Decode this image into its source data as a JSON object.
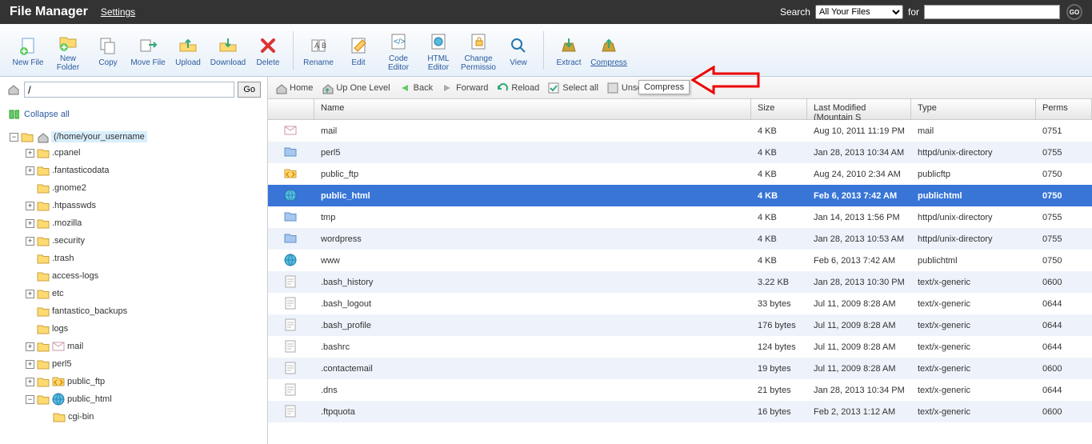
{
  "header": {
    "title": "File Manager",
    "settings": "Settings",
    "search_label": "Search",
    "search_scope": "All Your Files",
    "for_label": "for",
    "search_value": "",
    "go_label": "GO"
  },
  "toolbar": {
    "new_file": "New File",
    "new_folder": "New\nFolder",
    "copy": "Copy",
    "move_file": "Move File",
    "upload": "Upload",
    "download": "Download",
    "delete": "Delete",
    "rename": "Rename",
    "edit": "Edit",
    "code_editor": "Code\nEditor",
    "html_editor": "HTML\nEditor",
    "change_perm": "Change\nPermissio",
    "view": "View",
    "extract": "Extract",
    "compress": "Compress"
  },
  "tooltip": "Compress",
  "pathbar": {
    "path": "/",
    "go": "Go"
  },
  "tree": {
    "collapse": "Collapse all",
    "root": "(/home/your_username",
    "items": [
      {
        "name": ".cpanel",
        "expandable": true,
        "indent": 1
      },
      {
        "name": ".fantasticodata",
        "expandable": true,
        "indent": 1
      },
      {
        "name": ".gnome2",
        "expandable": false,
        "indent": 1
      },
      {
        "name": ".htpasswds",
        "expandable": true,
        "indent": 1
      },
      {
        "name": ".mozilla",
        "expandable": true,
        "indent": 1
      },
      {
        "name": ".security",
        "expandable": true,
        "indent": 1
      },
      {
        "name": ".trash",
        "expandable": false,
        "indent": 1
      },
      {
        "name": "access-logs",
        "expandable": false,
        "indent": 1
      },
      {
        "name": "etc",
        "expandable": true,
        "indent": 1
      },
      {
        "name": "fantastico_backups",
        "expandable": false,
        "indent": 1
      },
      {
        "name": "logs",
        "expandable": false,
        "indent": 1
      },
      {
        "name": "mail",
        "expandable": true,
        "indent": 1,
        "icon": "mail"
      },
      {
        "name": "perl5",
        "expandable": true,
        "indent": 1
      },
      {
        "name": "public_ftp",
        "expandable": true,
        "indent": 1,
        "icon": "ftp"
      },
      {
        "name": "public_html",
        "expandable": true,
        "expanded": true,
        "indent": 1,
        "icon": "globe"
      },
      {
        "name": "cgi-bin",
        "expandable": false,
        "indent": 2
      }
    ]
  },
  "navbar": {
    "home": "Home",
    "up": "Up One Level",
    "back": "Back",
    "forward": "Forward",
    "reload": "Reload",
    "select_all": "Select all",
    "unselect_all": "Unselect all"
  },
  "columns": {
    "name": "Name",
    "size": "Size",
    "mod": "Last Modified (Mountain S",
    "type": "Type",
    "perms": "Perms"
  },
  "files": [
    {
      "icon": "mail",
      "name": "mail",
      "size": "4 KB",
      "mod": "Aug 10, 2011 11:19 PM",
      "type": "mail",
      "perms": "0751"
    },
    {
      "icon": "folder",
      "name": "perl5",
      "size": "4 KB",
      "mod": "Jan 28, 2013 10:34 AM",
      "type": "httpd/unix-directory",
      "perms": "0755"
    },
    {
      "icon": "ftp",
      "name": "public_ftp",
      "size": "4 KB",
      "mod": "Aug 24, 2010 2:34 AM",
      "type": "publicftp",
      "perms": "0750"
    },
    {
      "icon": "globe",
      "name": "public_html",
      "size": "4 KB",
      "mod": "Feb 6, 2013 7:42 AM",
      "type": "publichtml",
      "perms": "0750",
      "selected": true
    },
    {
      "icon": "folder",
      "name": "tmp",
      "size": "4 KB",
      "mod": "Jan 14, 2013 1:56 PM",
      "type": "httpd/unix-directory",
      "perms": "0755"
    },
    {
      "icon": "folder",
      "name": "wordpress",
      "size": "4 KB",
      "mod": "Jan 28, 2013 10:53 AM",
      "type": "httpd/unix-directory",
      "perms": "0755"
    },
    {
      "icon": "globe",
      "name": "www",
      "size": "4 KB",
      "mod": "Feb 6, 2013 7:42 AM",
      "type": "publichtml",
      "perms": "0750"
    },
    {
      "icon": "file",
      "name": ".bash_history",
      "size": "3.22 KB",
      "mod": "Jan 28, 2013 10:30 PM",
      "type": "text/x-generic",
      "perms": "0600"
    },
    {
      "icon": "file",
      "name": ".bash_logout",
      "size": "33 bytes",
      "mod": "Jul 11, 2009 8:28 AM",
      "type": "text/x-generic",
      "perms": "0644"
    },
    {
      "icon": "file",
      "name": ".bash_profile",
      "size": "176 bytes",
      "mod": "Jul 11, 2009 8:28 AM",
      "type": "text/x-generic",
      "perms": "0644"
    },
    {
      "icon": "file",
      "name": ".bashrc",
      "size": "124 bytes",
      "mod": "Jul 11, 2009 8:28 AM",
      "type": "text/x-generic",
      "perms": "0644"
    },
    {
      "icon": "file",
      "name": ".contactemail",
      "size": "19 bytes",
      "mod": "Jul 11, 2009 8:28 AM",
      "type": "text/x-generic",
      "perms": "0600"
    },
    {
      "icon": "file",
      "name": ".dns",
      "size": "21 bytes",
      "mod": "Jan 28, 2013 10:34 PM",
      "type": "text/x-generic",
      "perms": "0644"
    },
    {
      "icon": "file",
      "name": ".ftpquota",
      "size": "16 bytes",
      "mod": "Feb 2, 2013 1:12 AM",
      "type": "text/x-generic",
      "perms": "0600"
    }
  ]
}
